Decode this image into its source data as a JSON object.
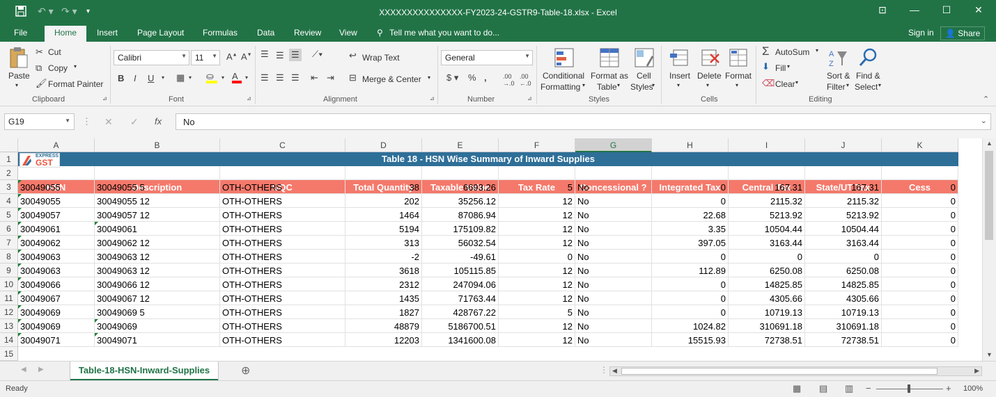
{
  "window": {
    "title": "XXXXXXXXXXXXXXX-FY2023-24-GSTR9-Table-18.xlsx - Excel"
  },
  "tabs": [
    "File",
    "Home",
    "Insert",
    "Page Layout",
    "Formulas",
    "Data",
    "Review",
    "View"
  ],
  "tell_me": "Tell me what you want to do...",
  "account": {
    "signin": "Sign in",
    "share": "Share"
  },
  "ribbon": {
    "clipboard": {
      "paste": "Paste",
      "cut": "Cut",
      "copy": "Copy",
      "format_painter": "Format Painter",
      "label": "Clipboard"
    },
    "font": {
      "name": "Calibri",
      "size": "11",
      "label": "Font"
    },
    "alignment": {
      "wrap": "Wrap Text",
      "merge": "Merge & Center",
      "label": "Alignment"
    },
    "number": {
      "format": "General",
      "label": "Number"
    },
    "styles": {
      "cond1": "Conditional",
      "cond2": "Formatting",
      "fmt1": "Format as",
      "fmt2": "Table",
      "cell1": "Cell",
      "cell2": "Styles",
      "label": "Styles"
    },
    "cells": {
      "insert": "Insert",
      "delete": "Delete",
      "format": "Format",
      "label": "Cells"
    },
    "editing": {
      "autosum": "AutoSum",
      "fill": "Fill",
      "clear": "Clear",
      "sort1": "Sort &",
      "sort2": "Filter",
      "find1": "Find &",
      "find2": "Select",
      "label": "Editing"
    }
  },
  "formula_bar": {
    "name_box": "G19",
    "value": "No"
  },
  "columns": [
    "A",
    "B",
    "C",
    "D",
    "E",
    "F",
    "G",
    "H",
    "I",
    "J",
    "K"
  ],
  "selected_column": "G",
  "logo": {
    "top": "EXPRESS",
    "bottom": "GST"
  },
  "banner_title": "Table 18 - HSN Wise Summary of Inward Supplies",
  "headers": [
    "HSN",
    "Description",
    "UQC",
    "Total Quantity",
    "Taxable Value",
    "Tax Rate",
    "Concessional ?",
    "Integrated Tax",
    "Central Tax",
    "State/UT Tax",
    "Cess"
  ],
  "rows": [
    {
      "n": "4",
      "c": [
        "30049055",
        "30049055 5",
        "OTH-OTHERS",
        "38",
        "6693.26",
        "5",
        "No",
        "0",
        "167.31",
        "167.31",
        "0"
      ]
    },
    {
      "n": "5",
      "c": [
        "30049055",
        "30049055 12",
        "OTH-OTHERS",
        "202",
        "35256.12",
        "12",
        "No",
        "0",
        "2115.32",
        "2115.32",
        "0"
      ]
    },
    {
      "n": "6",
      "c": [
        "30049057",
        "30049057 12",
        "OTH-OTHERS",
        "1464",
        "87086.94",
        "12",
        "No",
        "22.68",
        "5213.92",
        "5213.92",
        "0"
      ]
    },
    {
      "n": "7",
      "c": [
        "30049061",
        "30049061",
        "OTH-OTHERS",
        "5194",
        "175109.82",
        "12",
        "No",
        "3.35",
        "10504.44",
        "10504.44",
        "0"
      ]
    },
    {
      "n": "8",
      "c": [
        "30049062",
        "30049062 12",
        "OTH-OTHERS",
        "313",
        "56032.54",
        "12",
        "No",
        "397.05",
        "3163.44",
        "3163.44",
        "0"
      ]
    },
    {
      "n": "9",
      "c": [
        "30049063",
        "30049063 12",
        "OTH-OTHERS",
        "-2",
        "-49.61",
        "0",
        "No",
        "0",
        "0",
        "0",
        "0"
      ]
    },
    {
      "n": "10",
      "c": [
        "30049063",
        "30049063 12",
        "OTH-OTHERS",
        "3618",
        "105115.85",
        "12",
        "No",
        "112.89",
        "6250.08",
        "6250.08",
        "0"
      ]
    },
    {
      "n": "11",
      "c": [
        "30049066",
        "30049066 12",
        "OTH-OTHERS",
        "2312",
        "247094.06",
        "12",
        "No",
        "0",
        "14825.85",
        "14825.85",
        "0"
      ]
    },
    {
      "n": "12",
      "c": [
        "30049067",
        "30049067 12",
        "OTH-OTHERS",
        "1435",
        "71763.44",
        "12",
        "No",
        "0",
        "4305.66",
        "4305.66",
        "0"
      ]
    },
    {
      "n": "13",
      "c": [
        "30049069",
        "30049069 5",
        "OTH-OTHERS",
        "1827",
        "428767.22",
        "5",
        "No",
        "0",
        "10719.13",
        "10719.13",
        "0"
      ]
    },
    {
      "n": "14",
      "c": [
        "30049069",
        "30049069",
        "OTH-OTHERS",
        "48879",
        "5186700.51",
        "12",
        "No",
        "1024.82",
        "310691.18",
        "310691.18",
        "0"
      ]
    },
    {
      "n": "15",
      "c": [
        "30049071",
        "30049071",
        "OTH-OTHERS",
        "12203",
        "1341600.08",
        "12",
        "No",
        "15515.93",
        "72738.51",
        "72738.51",
        "0"
      ]
    }
  ],
  "sheet_tab": "Table-18-HSN-Inward-Supplies",
  "status": {
    "ready": "Ready",
    "zoom": "100%"
  }
}
